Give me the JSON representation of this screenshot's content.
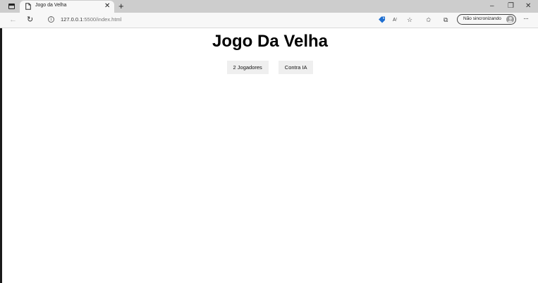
{
  "browser": {
    "tab": {
      "title": "Jogo da Velha",
      "close": "✕"
    },
    "new_tab": "+",
    "window_controls": {
      "minimize": "–",
      "restore": "❐",
      "close": "✕"
    },
    "address_bar": {
      "url_host": "127.0.0.1",
      "url_rest": ":5500/index.html"
    },
    "profile": {
      "label": "Não sincronizando"
    },
    "more": "···"
  },
  "page": {
    "title": "Jogo Da Velha",
    "buttons": {
      "two_players": "2 Jogadores",
      "vs_ai": "Contra IA"
    }
  }
}
